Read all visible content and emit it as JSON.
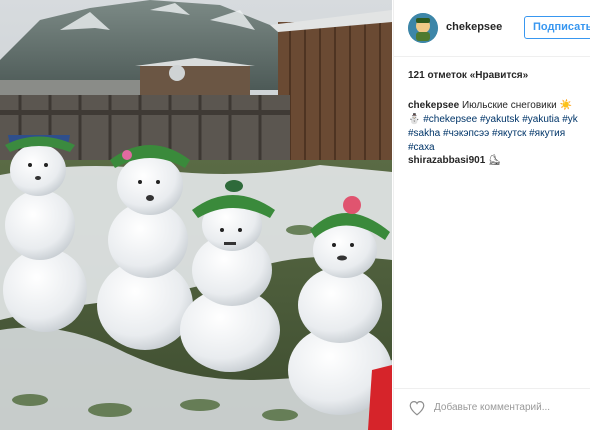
{
  "post": {
    "username": "chekepsee",
    "follow_label": "Подписаться",
    "likes": "121 отметок «Нравится»",
    "caption": {
      "username": "chekepsee",
      "text": "Июльские снеговики ☀️",
      "line2_emoji": "⛄",
      "tags": [
        "#chekepsee",
        "#yakutsk",
        "#yakutia",
        "#yk",
        "#sakha",
        "#чэкэпсээ",
        "#якутск",
        "#якутия",
        "#саха"
      ]
    },
    "comments": [
      {
        "username": "shirazabbasi901",
        "emoji": "⛸"
      }
    ],
    "comment_placeholder": "Добавьте комментарий..."
  },
  "colors": {
    "follow_blue": "#3897f0",
    "hashtag_blue": "#003569",
    "text": "#262626",
    "muted": "#999999",
    "divider": "#efefef"
  },
  "icons": {
    "like": "heart-outline-icon",
    "avatar": "profile-avatar"
  }
}
